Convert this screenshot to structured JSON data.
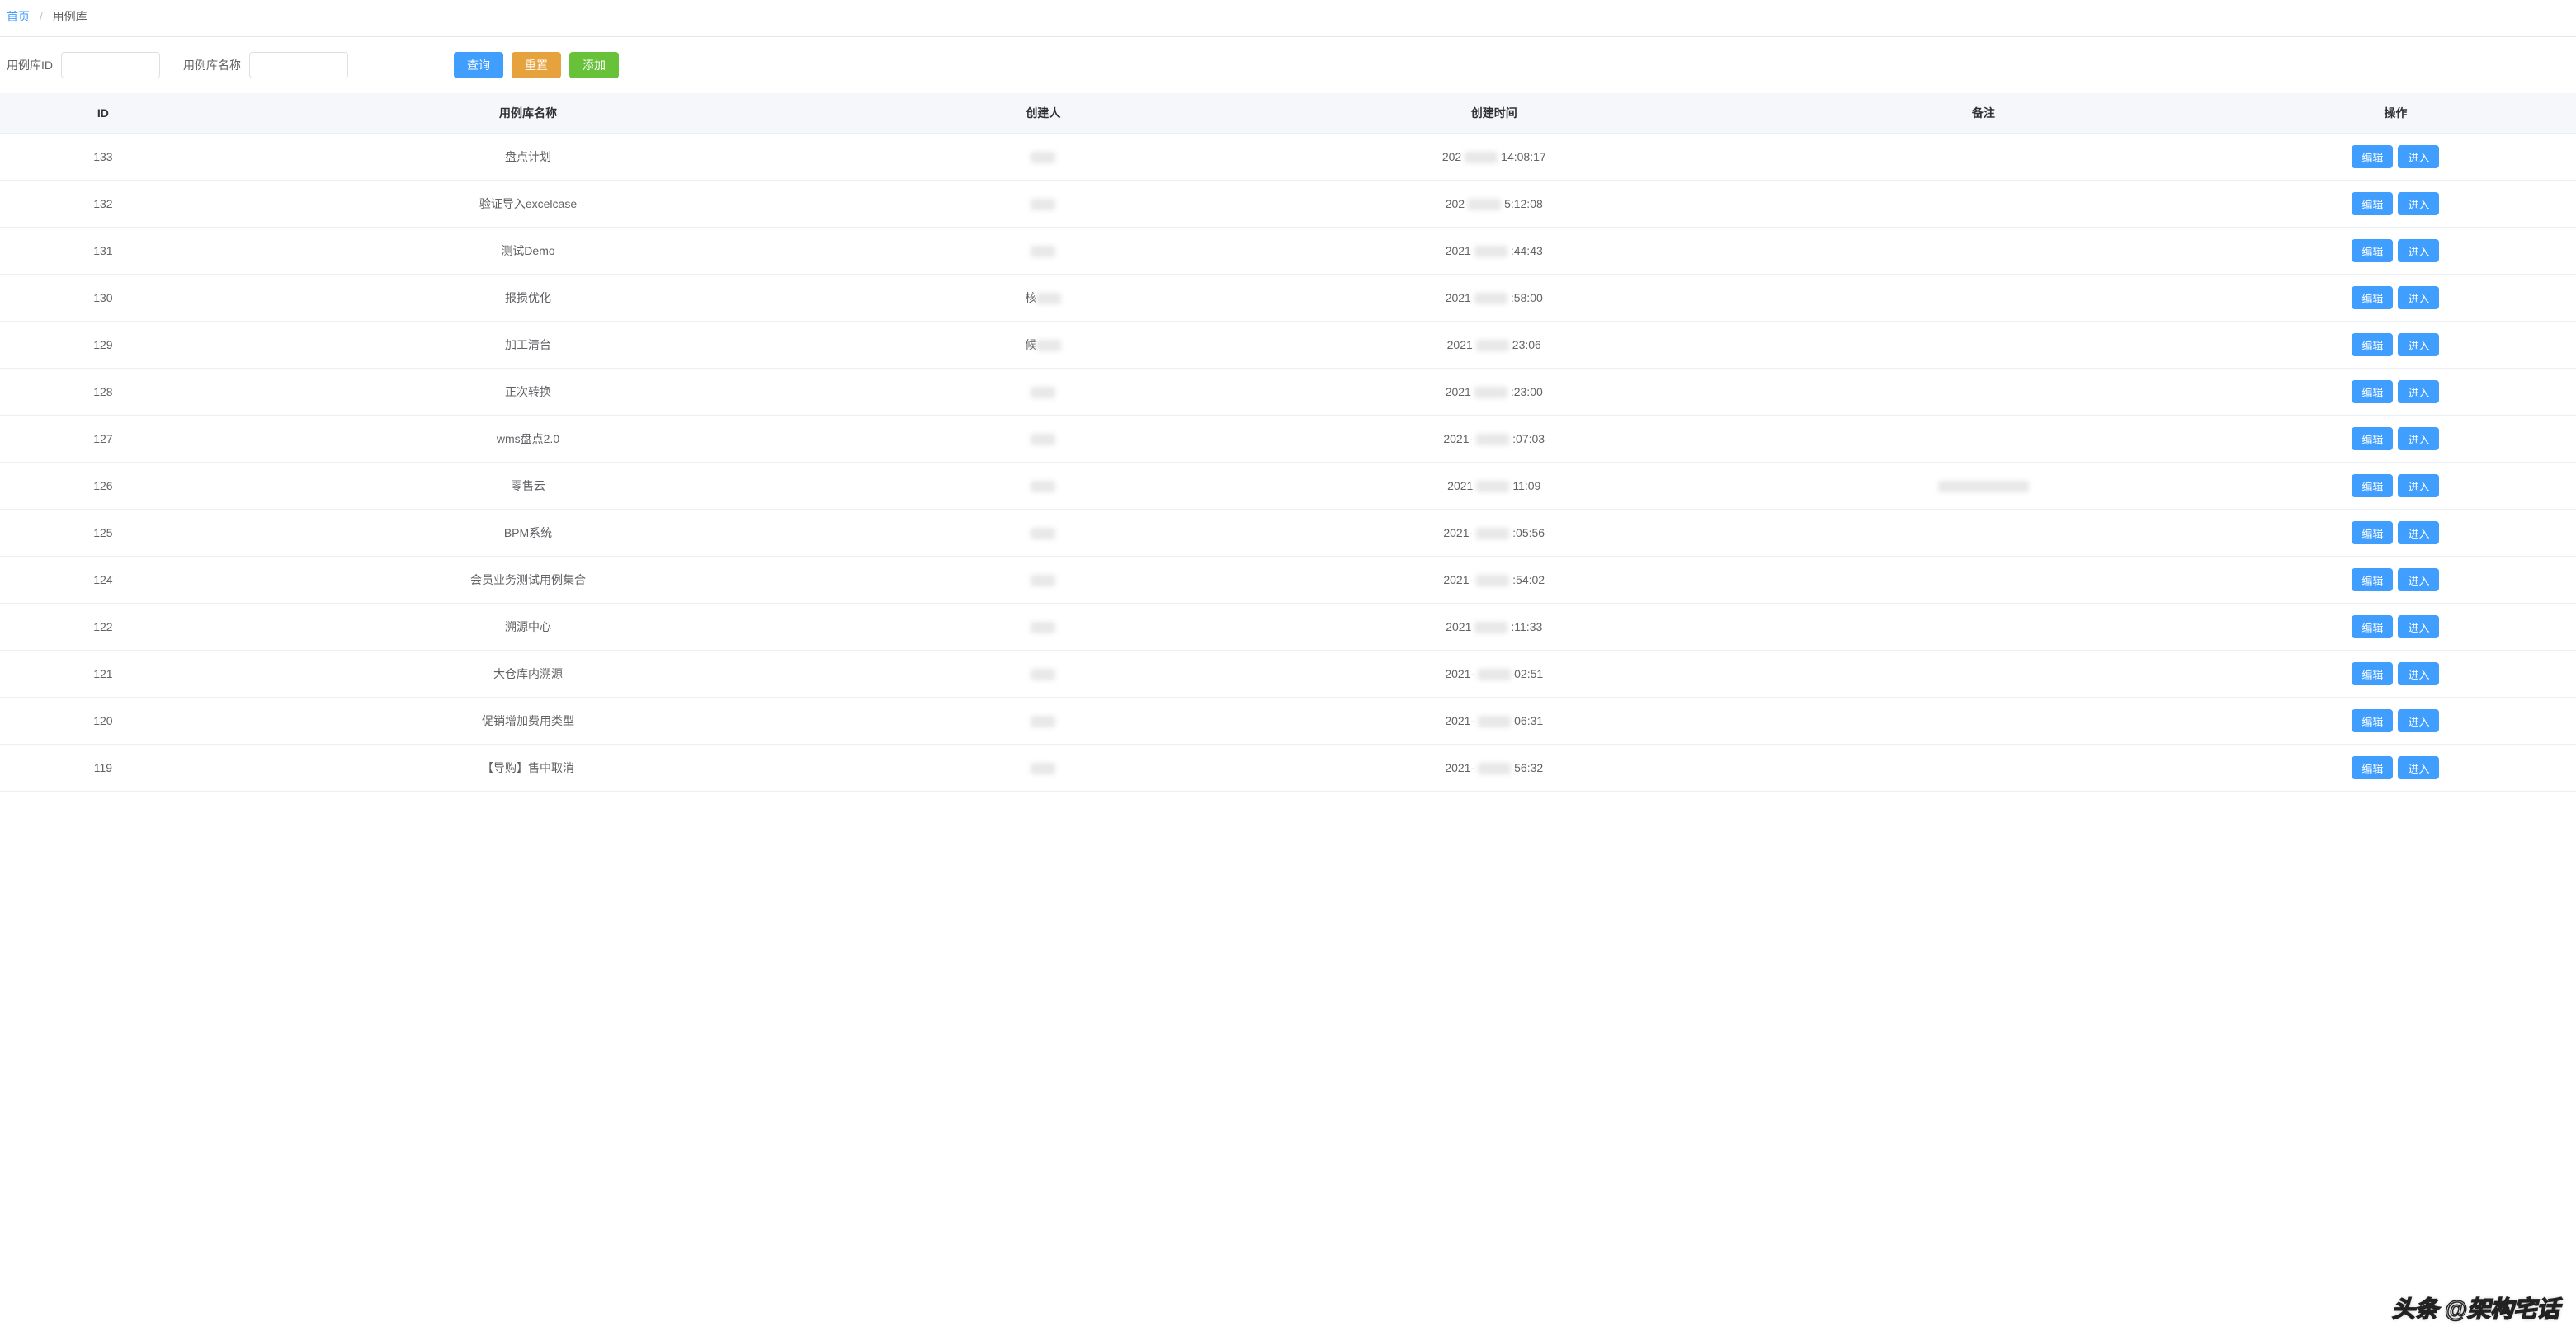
{
  "breadcrumb": {
    "home": "首页",
    "current": "用例库"
  },
  "filter": {
    "id_label": "用例库ID",
    "name_label": "用例库名称",
    "id_value": "",
    "name_value": ""
  },
  "buttons": {
    "search": "查询",
    "reset": "重置",
    "add": "添加"
  },
  "columns": {
    "id": "ID",
    "name": "用例库名称",
    "creator": "创建人",
    "time": "创建时间",
    "note": "备注",
    "action": "操作"
  },
  "row_buttons": {
    "edit": "编辑",
    "enter": "进入"
  },
  "rows": [
    {
      "id": "133",
      "name": "盘点计划",
      "creator_visible": "",
      "time_prefix": "202",
      "time_suffix": "14:08:17",
      "note": ""
    },
    {
      "id": "132",
      "name": "验证导入excelcase",
      "creator_visible": "",
      "time_prefix": "202",
      "time_suffix": "5:12:08",
      "note": ""
    },
    {
      "id": "131",
      "name": "测试Demo",
      "creator_visible": "",
      "time_prefix": "2021",
      "time_suffix": ":44:43",
      "note": ""
    },
    {
      "id": "130",
      "name": "报损优化",
      "creator_visible": "核",
      "time_prefix": "2021",
      "time_suffix": ":58:00",
      "note": ""
    },
    {
      "id": "129",
      "name": "加工清台",
      "creator_visible": "候",
      "time_prefix": "2021",
      "time_suffix": "23:06",
      "note": ""
    },
    {
      "id": "128",
      "name": "正次转换",
      "creator_visible": "",
      "time_prefix": "2021",
      "time_suffix": ":23:00",
      "note": ""
    },
    {
      "id": "127",
      "name": "wms盘点2.0",
      "creator_visible": "",
      "time_prefix": "2021-",
      "time_suffix": ":07:03",
      "note": ""
    },
    {
      "id": "126",
      "name": "零售云",
      "creator_visible": "",
      "time_prefix": "2021",
      "time_suffix": "11:09",
      "note": "(redacted)"
    },
    {
      "id": "125",
      "name": "BPM系统",
      "creator_visible": "",
      "time_prefix": "2021-",
      "time_suffix": ":05:56",
      "note": ""
    },
    {
      "id": "124",
      "name": "会员业务测试用例集合",
      "creator_visible": "",
      "time_prefix": "2021-",
      "time_suffix": ":54:02",
      "note": ""
    },
    {
      "id": "122",
      "name": "溯源中心",
      "creator_visible": "",
      "time_prefix": "2021",
      "time_suffix": ":11:33",
      "note": ""
    },
    {
      "id": "121",
      "name": "大仓库内溯源",
      "creator_visible": "",
      "time_prefix": "2021-",
      "time_suffix": "02:51",
      "note": ""
    },
    {
      "id": "120",
      "name": "促销增加费用类型",
      "creator_visible": "",
      "time_prefix": "2021-",
      "time_suffix": "06:31",
      "note": ""
    },
    {
      "id": "119",
      "name": "【导购】售中取消",
      "creator_visible": "",
      "time_prefix": "2021-",
      "time_suffix": "56:32",
      "note": ""
    }
  ],
  "watermark": "头条 @架构宅话"
}
